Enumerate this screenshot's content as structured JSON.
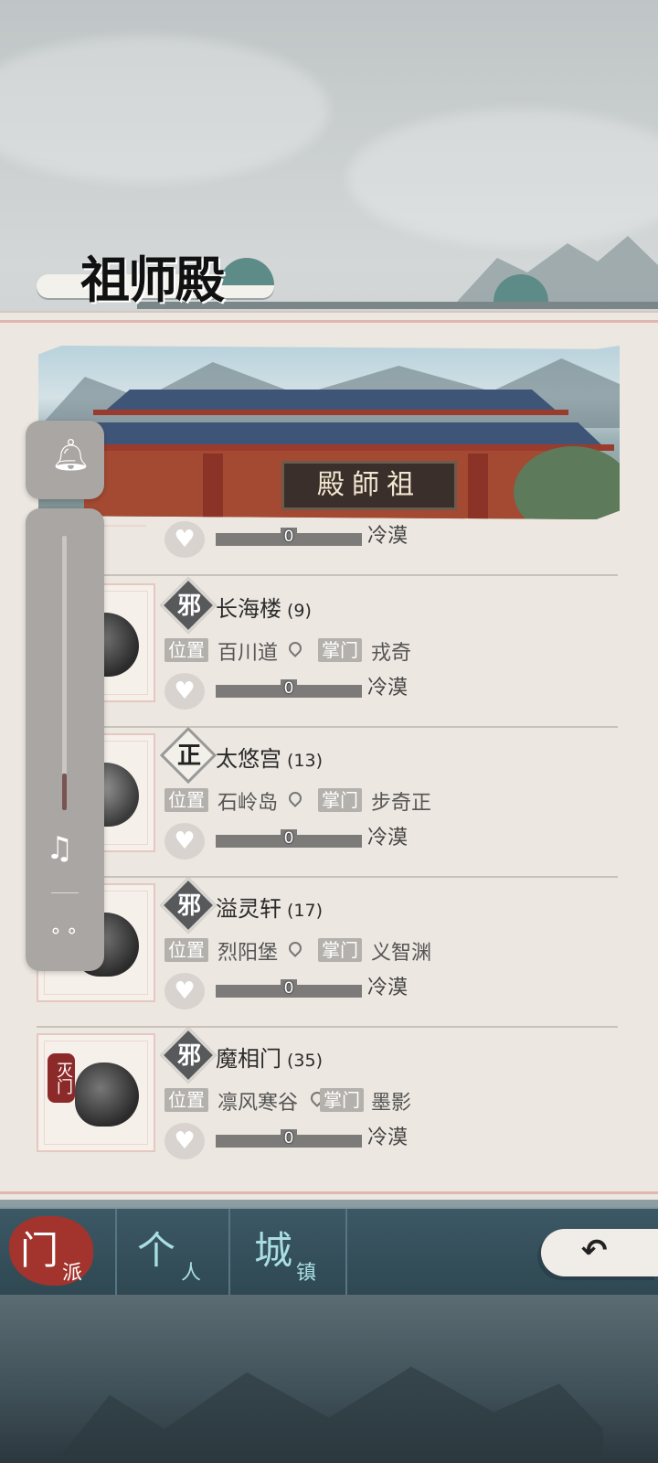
{
  "header": {
    "title": "祖师殿"
  },
  "banner": {
    "plaque_text": "殿師祖"
  },
  "controls": {
    "bell_icon": "bell-icon",
    "music_icon": "music-note-icon",
    "more_icon": "more-dots-icon",
    "volume_level": 0.13
  },
  "partial_row": {
    "affinity": "0",
    "status": "冷漠"
  },
  "labels": {
    "location": "位置",
    "leader": "掌门"
  },
  "sects": [
    {
      "alignment": "邪",
      "name": "长海楼",
      "count": "(9)",
      "location": "百川道",
      "leader": "戎奇",
      "affinity": "0",
      "status": "冷漠"
    },
    {
      "alignment": "正",
      "name": "太悠宫",
      "count": "(13)",
      "location": "石岭岛",
      "leader": "步奇正",
      "affinity": "0",
      "status": "冷漠"
    },
    {
      "alignment": "邪",
      "name": "溢灵轩",
      "count": "(17)",
      "location": "烈阳堡",
      "leader": "义智渊",
      "affinity": "0",
      "status": "冷漠"
    },
    {
      "alignment": "邪",
      "name": "魔相门",
      "count": "(35)",
      "location": "凛风寒谷",
      "leader": "墨影",
      "affinity": "0",
      "status": "冷漠",
      "seal": "灭门"
    }
  ],
  "nav": {
    "tabs": [
      {
        "main": "门",
        "sub": "派"
      },
      {
        "main": "个",
        "sub": "人"
      },
      {
        "main": "城",
        "sub": "镇"
      }
    ],
    "back_icon": "back-arrow-icon"
  },
  "colors": {
    "active_tab": "#a2342d",
    "nav_bg": "#3c5865",
    "panel_bg": "#ece7e0"
  }
}
